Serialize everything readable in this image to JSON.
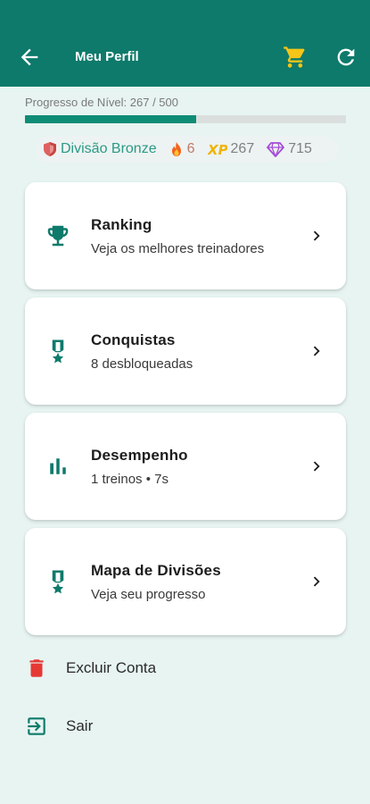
{
  "header": {
    "title": "Meu Perfil",
    "back_icon": "arrow-left-icon",
    "cart_icon": "shopping-cart-icon",
    "refresh_icon": "refresh-icon"
  },
  "progress": {
    "label": "Progresso de Nível: 267 / 500",
    "current": 267,
    "max": 500
  },
  "stats": {
    "division": "Divisão Bronze",
    "streak": "6",
    "xp_badge": "XP",
    "xp": "267",
    "gems": "715"
  },
  "cards": [
    {
      "title": "Ranking",
      "subtitle": "Veja os melhores treinadores",
      "icon": "trophy-icon"
    },
    {
      "title": "Conquistas",
      "subtitle": "8 desbloqueadas",
      "icon": "medal-icon"
    },
    {
      "title": "Desempenho",
      "subtitle": "1 treinos • 7s",
      "icon": "bar-chart-icon"
    },
    {
      "title": "Mapa de Divisões",
      "subtitle": "Veja seu progresso",
      "icon": "medal-icon"
    }
  ],
  "actions": {
    "delete_label": "Excluir Conta",
    "logout_label": "Sair"
  },
  "colors": {
    "primary": "#0e7a6b",
    "background": "#e7f4f1",
    "cart": "#f5c518",
    "danger": "#e53935",
    "gem": "#a54bd6"
  }
}
